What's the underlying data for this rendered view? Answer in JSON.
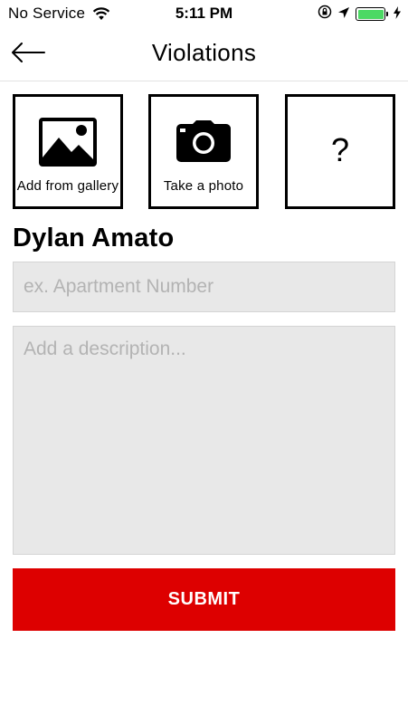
{
  "status_bar": {
    "carrier": "No Service",
    "time": "5:11 PM",
    "battery_level": 1.0,
    "battery_color": "#4cd964",
    "icons": [
      "wifi-icon",
      "orientation-lock-icon",
      "location-icon",
      "battery-icon",
      "charging-icon"
    ]
  },
  "nav": {
    "title": "Violations",
    "back_icon": "arrow-left-icon"
  },
  "tiles": [
    {
      "label": "Add from gallery",
      "icon": "image-icon"
    },
    {
      "label": "Take a photo",
      "icon": "camera-icon"
    },
    {
      "label": "?",
      "icon": "question-mark"
    }
  ],
  "user": {
    "name": "Dylan Amato"
  },
  "form": {
    "apartment_placeholder": "ex. Apartment Number",
    "apartment_value": "",
    "description_placeholder": "Add a description...",
    "description_value": ""
  },
  "submit": {
    "label": "SUBMIT",
    "color": "#dd0000"
  }
}
